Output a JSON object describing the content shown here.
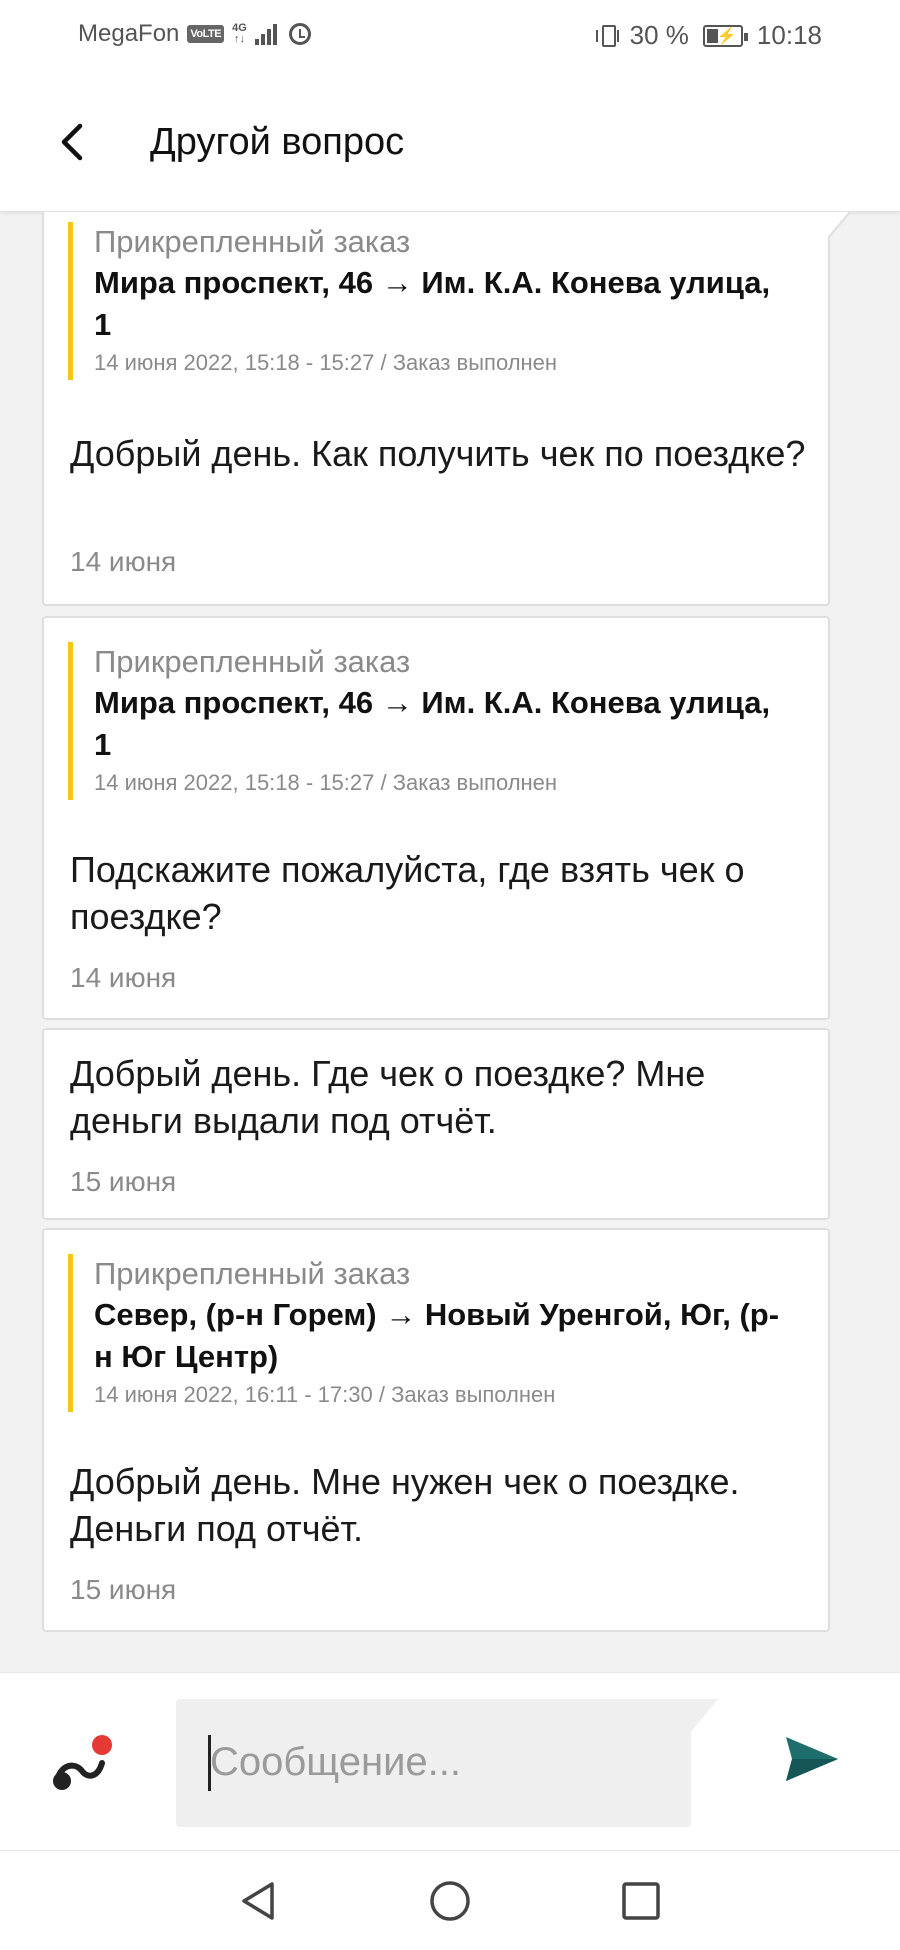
{
  "status_bar": {
    "carrier": "MegaFon",
    "volte": "VoLTE",
    "network": "4G",
    "battery": "30 %",
    "time": "10:18"
  },
  "header": {
    "title": "Другой вопрос",
    "back_icon": "back-arrow-icon"
  },
  "messages": [
    {
      "attached_label": "Прикрепленный заказ",
      "attached_route": "Мира проспект, 46 → Им. К.А. Конева улица, 1",
      "attached_meta": "14 июня 2022, 15:18 - 15:27 / Заказ выполнен",
      "text": "Добрый день. Как получить чек по поездке?",
      "date": "14 июня"
    },
    {
      "attached_label": "Прикрепленный заказ",
      "attached_route": "Мира проспект, 46 → Им. К.А. Конева улица, 1",
      "attached_meta": "14 июня 2022, 15:18 - 15:27 / Заказ выполнен",
      "text": "Подскажите пожалуйста, где взять чек о поездке?",
      "date": "14 июня"
    },
    {
      "text": "Добрый день. Где чек о поездке? Мне деньги выдали под отчёт.",
      "date": "15 июня"
    },
    {
      "attached_label": "Прикрепленный заказ",
      "attached_route": "Север, (р-н Горем) → Новый Уренгой, Юг, (р-н Юг Центр)",
      "attached_meta": "14 июня 2022, 16:11 - 17:30 / Заказ выполнен",
      "text": "Добрый день. Мне нужен чек о поездке. Деньги под отчёт.",
      "date": "15 июня"
    }
  ],
  "composer": {
    "placeholder": "Сообщение...",
    "value": "",
    "logo_icon": "app-logo-icon",
    "send_icon": "send-icon"
  },
  "nav": {
    "back_icon": "nav-back-icon",
    "home_icon": "nav-home-icon",
    "recents_icon": "nav-recents-icon"
  },
  "colors": {
    "accent_yellow": "#f5c518",
    "send_teal": "#1f6e6e",
    "logo_red": "#e53935"
  }
}
